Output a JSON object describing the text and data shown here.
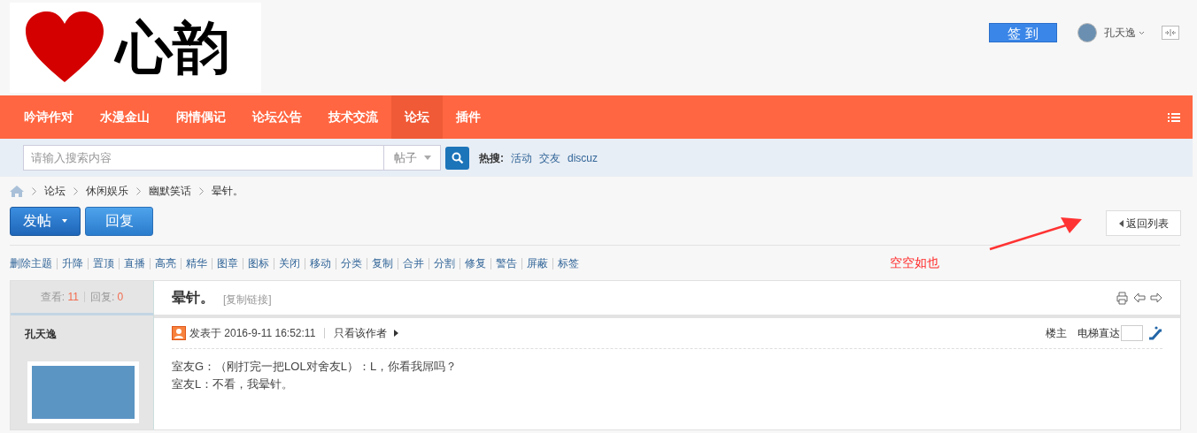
{
  "logo": {
    "text": "心韵"
  },
  "header": {
    "signin_button": "签 到",
    "username": "孔天逸"
  },
  "nav": {
    "items": [
      {
        "label": "吟诗作对",
        "selected": false
      },
      {
        "label": "水漫金山",
        "selected": false
      },
      {
        "label": "闲情偶记",
        "selected": false
      },
      {
        "label": "论坛公告",
        "selected": false
      },
      {
        "label": "技术交流",
        "selected": false
      },
      {
        "label": "论坛",
        "selected": true
      },
      {
        "label": "插件",
        "selected": false
      }
    ]
  },
  "search": {
    "placeholder": "请输入搜索内容",
    "type": "帖子",
    "hot_label": "热搜:",
    "hot_links": [
      "活动",
      "交友",
      "discuz"
    ]
  },
  "breadcrumb": [
    "论坛",
    "休闲娱乐",
    "幽默笑话",
    "晕针。"
  ],
  "actions": {
    "post_button": "发帖",
    "reply_button": "回复",
    "back_button": "返回列表"
  },
  "admin_links": [
    "删除主题",
    "升降",
    "置顶",
    "直播",
    "高亮",
    "精华",
    "图章",
    "图标",
    "关闭",
    "移动",
    "分类",
    "复制",
    "合并",
    "分割",
    "修复",
    "警告",
    "屏蔽",
    "标签"
  ],
  "annotation": {
    "text": "空空如也"
  },
  "thread": {
    "views_label": "查看:",
    "views": "11",
    "replies_label": "回复:",
    "replies": "0",
    "title": "晕针。",
    "copy_link": "[复制链接]"
  },
  "post": {
    "author": "孔天逸",
    "posted": "发表于 2016-9-11 16:52:11",
    "only_author": "只看该作者",
    "floor": "楼主",
    "jump_label": "电梯直达",
    "lines": [
      "室友G：（刚打完一把LOL对舍友L）：L，你看我屌吗？",
      "室友L：不看，我晕针。"
    ]
  }
}
